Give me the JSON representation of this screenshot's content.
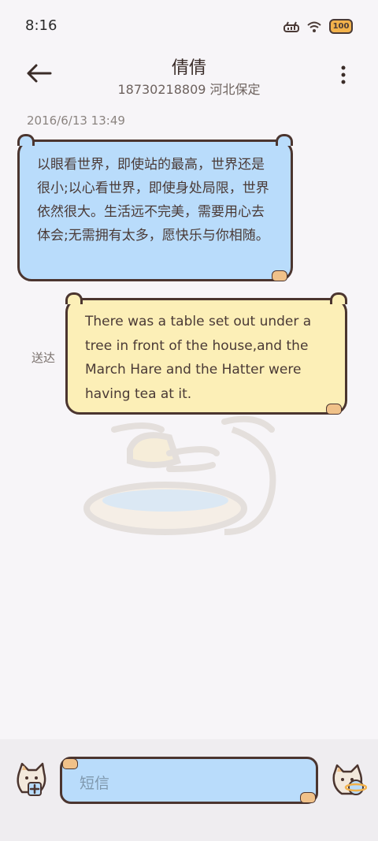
{
  "status_bar": {
    "time": "8:16",
    "battery_label": "100"
  },
  "header": {
    "contact_name": "倩倩",
    "contact_subtitle": "18730218809 河北保定"
  },
  "conversation": {
    "timestamp": "2016/6/13 13:49",
    "incoming_message": "以眼看世界，即使站的最高，世界还是很小;以心看世界，即使身处局限，世界依然很大。生活远不完美，需要用心去体会;无需拥有太多，愿快乐与你相随。",
    "outgoing_message": "There was a table set out under a tree in front of the house,and the March Hare and the Hatter were having tea at it.",
    "delivery_status": "送达"
  },
  "composer": {
    "placeholder": "短信"
  },
  "colors": {
    "incoming_bubble": "#b9dcfb",
    "outgoing_bubble": "#fcefb7",
    "outline": "#4b352f",
    "background": "#f7f5f8"
  }
}
